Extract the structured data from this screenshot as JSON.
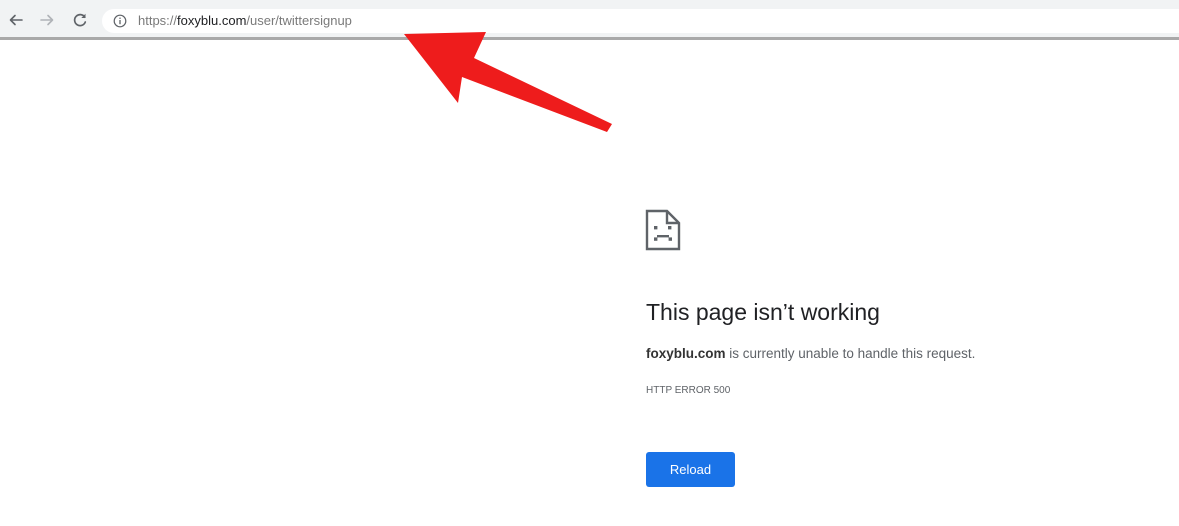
{
  "browser": {
    "back_icon": "arrow-left-icon",
    "forward_icon": "arrow-right-icon",
    "reload_icon": "reload-icon",
    "site_info_icon": "info-icon",
    "url": {
      "scheme": "https://",
      "host": "foxyblu.com",
      "path": "/user/twittersignup"
    }
  },
  "annotation": {
    "arrow_color": "#ee1c1c"
  },
  "error_page": {
    "icon": "sad-page-icon",
    "title": "This page isn’t working",
    "domain": "foxyblu.com",
    "description": " is currently unable to handle this request.",
    "error_code": "HTTP ERROR 500",
    "reload_label": "Reload",
    "reload_color": "#1a73e8"
  }
}
